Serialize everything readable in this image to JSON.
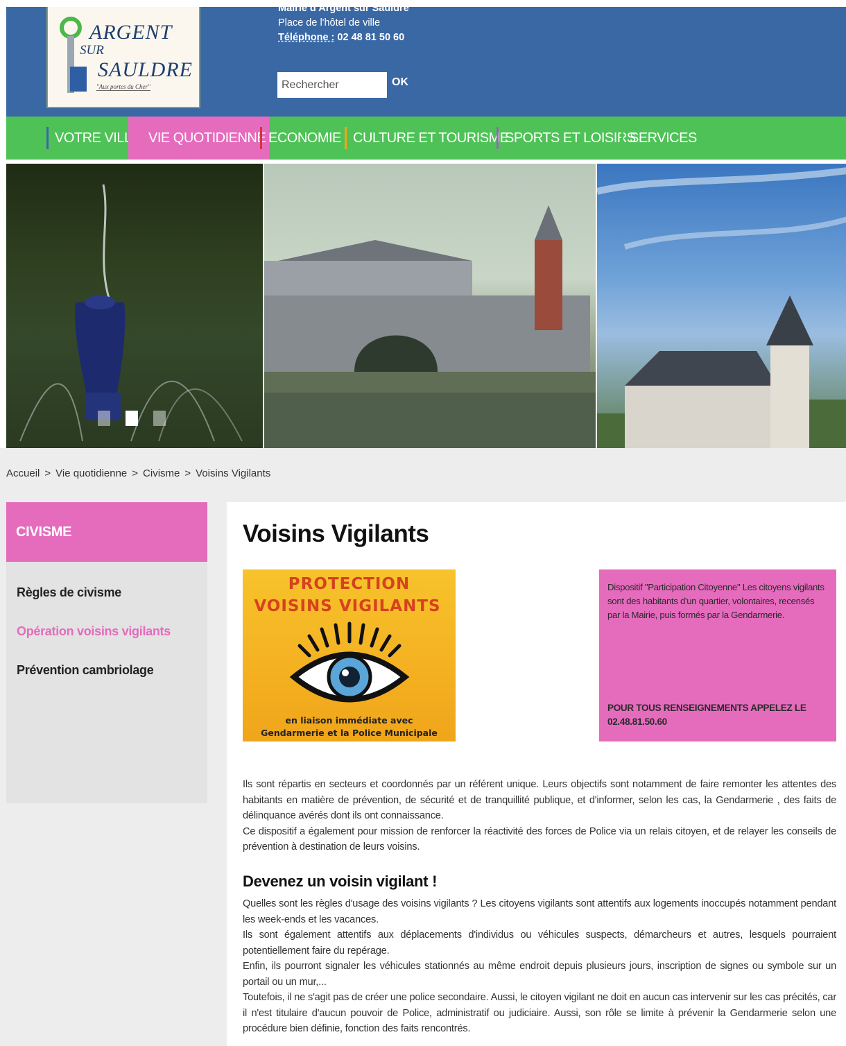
{
  "header": {
    "logo": {
      "line1": "ARGENT",
      "line2": "SUR",
      "line3": "SAULDRE",
      "tagline": "\"Aux portes du Cher\""
    },
    "contact": {
      "mairie": "Mairie d'Argent sur Sauldre",
      "address": "Place de l'hôtel de ville",
      "phone_label": "Téléphone :",
      "phone": "02 48 81 50 60"
    },
    "search": {
      "placeholder": "Rechercher",
      "button": "OK"
    }
  },
  "nav": {
    "items": [
      {
        "label": "VOTRE VILLE",
        "sep_color": "#3a68a5"
      },
      {
        "label": "VIE QUOTIDIENNE",
        "sep_color": "#e56bbd"
      },
      {
        "label": "ECONOMIE",
        "sep_color": "#d9323b"
      },
      {
        "label": "CULTURE ET TOURISME",
        "sep_color": "#f0a51a"
      },
      {
        "label": "SPORTS ET LOISIRS",
        "sep_color": "#8e6bb0"
      },
      {
        "label": "SERVICES",
        "sep_color": "#4fc257"
      }
    ],
    "active_index": 1
  },
  "slider": {
    "dots": 3,
    "active_dot": 1
  },
  "breadcrumb": {
    "items": [
      "Accueil",
      "Vie quotidienne",
      "Civisme",
      "Voisins Vigilants"
    ],
    "separator": ">"
  },
  "sidebar": {
    "title": "CIVISME",
    "items": [
      {
        "label": "Règles de civisme"
      },
      {
        "label": "Opération voisins vigilants"
      },
      {
        "label": "Prévention cambriolage"
      }
    ],
    "current_index": 1
  },
  "main": {
    "title": "Voisins Vigilants",
    "poster": {
      "line1": "PROTECTION",
      "line2": "VOISINS VIGILANTS",
      "bottom1": "en liaison immédiate avec",
      "bottom2": "Gendarmerie et la Police Municipale"
    },
    "infobox": {
      "intro": "Dispositif \"Participation Citoyenne\" Les citoyens vigilants sont des habitants d'un quartier, volontaires, recensés par la Mairie, puis formés par la Gendarmerie.",
      "call": "POUR TOUS RENSEIGNEMENTS APPELEZ LE 02.48.81.50.60"
    },
    "paragraph1": "Ils sont répartis en secteurs et coordonnés par un référent unique. Leurs objectifs sont notamment de faire remonter les attentes des habitants en matière de prévention, de sécurité et de tranquillité publique, et d'informer, selon les cas, la Gendarmerie , des faits de délinquance avérés dont ils ont connaissance.",
    "paragraph2": "Ce dispositif a également pour mission de renforcer la réactivité des forces de Police via un relais citoyen, et de relayer les conseils de prévention à destination de leurs voisins.",
    "subheading": "Devenez un voisin vigilant !",
    "paragraph3": "Quelles sont les règles d'usage des voisins vigilants ? Les citoyens vigilants sont attentifs aux logements inoccupés notamment pendant les week-ends et les vacances.",
    "paragraph4": "Ils sont également attentifs aux déplacements d'individus ou véhicules suspects, démarcheurs et autres, lesquels pourraient potentiellement faire du repérage.",
    "paragraph5": "Enfin, ils pourront signaler les véhicules stationnés au même endroit depuis plusieurs jours, inscription de signes ou symbole sur un portail ou un mur,...",
    "paragraph6": "Toutefois, il ne s'agit pas de créer une police secondaire. Aussi, le citoyen vigilant ne doit en aucun cas intervenir sur les cas précités, car il n'est titulaire d'aucun pouvoir de Police, administratif ou judiciaire. Aussi, son rôle se limite à prévenir la Gendarmerie selon une procédure bien définie, fonction des faits rencontrés."
  },
  "colors": {
    "header_blue": "#3a68a5",
    "nav_green": "#4fc257",
    "accent_pink": "#e56bbd"
  }
}
